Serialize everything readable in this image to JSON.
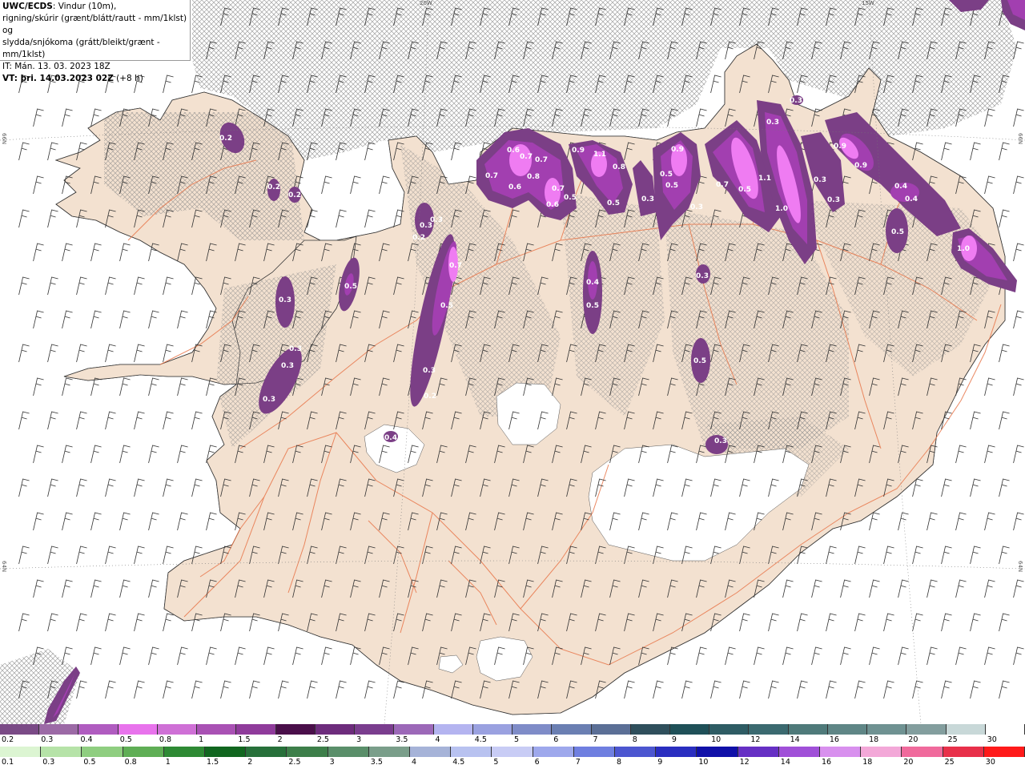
{
  "header": {
    "title_bold": "UWC/ECDS",
    "title_rest": ": Vindur (10m),",
    "line2": "rigning/skúrir (grænt/blátt/rautt - mm/1klst) og",
    "line3": "slydda/snjókoma (grátt/bleikt/grænt - mm/1klst)",
    "line4": "IT: Mán. 13. 03. 2023 18Z",
    "vt_bold": "VT: þri. 14.03.2023 02Z",
    "vt_rest": " (+8 h)"
  },
  "grid_labels": {
    "lon_20w": "20W",
    "lon_15w": "15W",
    "lat_66n_left": "66N",
    "lat_66n_right": "66N",
    "lat_64n_left": "64N",
    "lat_64n_right": "64N"
  },
  "colors": {
    "land": "#f3e1d0",
    "roads": "#e8764a",
    "ice": "#ffffff",
    "precip_light": "#7b3f86",
    "precip_mid": "#a23fb0",
    "precip_high": "#ef7cf2",
    "hatch": "#8a8a8a"
  },
  "precip_labels": [
    {
      "text": "0.2"
    },
    {
      "text": "0.2"
    },
    {
      "text": "0.2"
    },
    {
      "text": "0.3"
    },
    {
      "text": "0.5"
    },
    {
      "text": "0.3"
    },
    {
      "text": "0.3"
    },
    {
      "text": "0.3"
    },
    {
      "text": "0.4"
    },
    {
      "text": "0.3"
    },
    {
      "text": "0.2"
    },
    {
      "text": "0.3"
    },
    {
      "text": "0.7"
    },
    {
      "text": "0.5"
    },
    {
      "text": "0.3"
    },
    {
      "text": "0.2"
    },
    {
      "text": "0.6"
    },
    {
      "text": "0.7"
    },
    {
      "text": "0.7"
    },
    {
      "text": "0.8"
    },
    {
      "text": "0.6"
    },
    {
      "text": "0.7"
    },
    {
      "text": "0.7"
    },
    {
      "text": "0.6"
    },
    {
      "text": "0.5"
    },
    {
      "text": "0.9"
    },
    {
      "text": "1.1"
    },
    {
      "text": "0.8"
    },
    {
      "text": "0.5"
    },
    {
      "text": "0.3"
    },
    {
      "text": "0.4"
    },
    {
      "text": "0.5"
    },
    {
      "text": "0.9"
    },
    {
      "text": "0.5"
    },
    {
      "text": "0.5"
    },
    {
      "text": "0.7"
    },
    {
      "text": "0.5"
    },
    {
      "text": "1.1"
    },
    {
      "text": "1.0"
    },
    {
      "text": "0.3"
    },
    {
      "text": "0.3"
    },
    {
      "text": "0.3"
    },
    {
      "text": "0.9"
    },
    {
      "text": "0.9"
    },
    {
      "text": "0.4"
    },
    {
      "text": "0.4"
    },
    {
      "text": "0.3"
    },
    {
      "text": "0.5"
    },
    {
      "text": "1.0"
    },
    {
      "text": "0.3"
    },
    {
      "text": "0.5"
    },
    {
      "text": "0.3"
    },
    {
      "text": "0.3"
    }
  ],
  "legend_snow": {
    "labels": [
      "0.2",
      "0.3",
      "0.4",
      "0.5",
      "0.8",
      "1",
      "1.5",
      "2",
      "2.5",
      "3",
      "3.5",
      "4",
      "4.5",
      "5",
      "6",
      "7",
      "8",
      "9",
      "10",
      "12",
      "14",
      "16",
      "18",
      "20",
      "25",
      "30"
    ],
    "colors": [
      "#7a4a86",
      "#9c6aa6",
      "#b05cc0",
      "#e873ec",
      "#cf70d6",
      "#a951b4",
      "#8f3b9b",
      "#4a0f4a",
      "#6d2c7c",
      "#7a3d8e",
      "#9c68b8",
      "#b4b4f0",
      "#9aa1e0",
      "#7f8cc8",
      "#6b7fb2",
      "#5b6f96",
      "#2f4f5c",
      "#1f5058",
      "#2e5c64",
      "#3b6a70",
      "#4f7a7a",
      "#5f8686",
      "#6f9292",
      "#839e9e",
      "#c8d8d8",
      "#ffffff"
    ]
  },
  "legend_rain": {
    "labels": [
      "0.1",
      "0.3",
      "0.5",
      "0.8",
      "1",
      "1.5",
      "2",
      "2.5",
      "3",
      "3.5",
      "4",
      "4.5",
      "5",
      "6",
      "7",
      "8",
      "9",
      "10",
      "12",
      "14",
      "16",
      "18",
      "20",
      "25",
      "30"
    ],
    "colors": [
      "#dcf5d2",
      "#b6e3a8",
      "#8fce80",
      "#5fae55",
      "#2e8a34",
      "#11661f",
      "#27703a",
      "#3d7f4a",
      "#5a8f6a",
      "#7a9e8a",
      "#a6b3d8",
      "#b8c2f0",
      "#c8ccf5",
      "#9ea8ec",
      "#6f7fe0",
      "#4c56d0",
      "#2a2ec0",
      "#1010a8",
      "#6630c4",
      "#a050d8",
      "#d890ee",
      "#f3a8d8",
      "#f06a9c",
      "#e8304a",
      "#ff1a1a"
    ]
  }
}
